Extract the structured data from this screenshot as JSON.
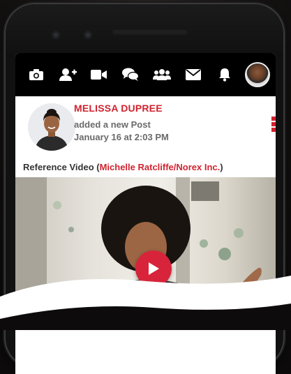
{
  "toolbar": {
    "icons": [
      "camera-icon",
      "add-friend-icon",
      "video-icon",
      "chat-icon",
      "group-icon",
      "mail-icon",
      "bell-icon"
    ]
  },
  "post": {
    "author": "MELISSA DUPREE",
    "action": "added a new Post",
    "date": "January 16 at 2:03 PM",
    "ref_prefix": "Reference Video (",
    "ref_link": "Michelle Ratcliffe/Norex Inc.",
    "ref_suffix": ")"
  },
  "colors": {
    "accent": "#d0232f",
    "toolbar_bg": "#000000",
    "play_button": "#d8243a"
  }
}
